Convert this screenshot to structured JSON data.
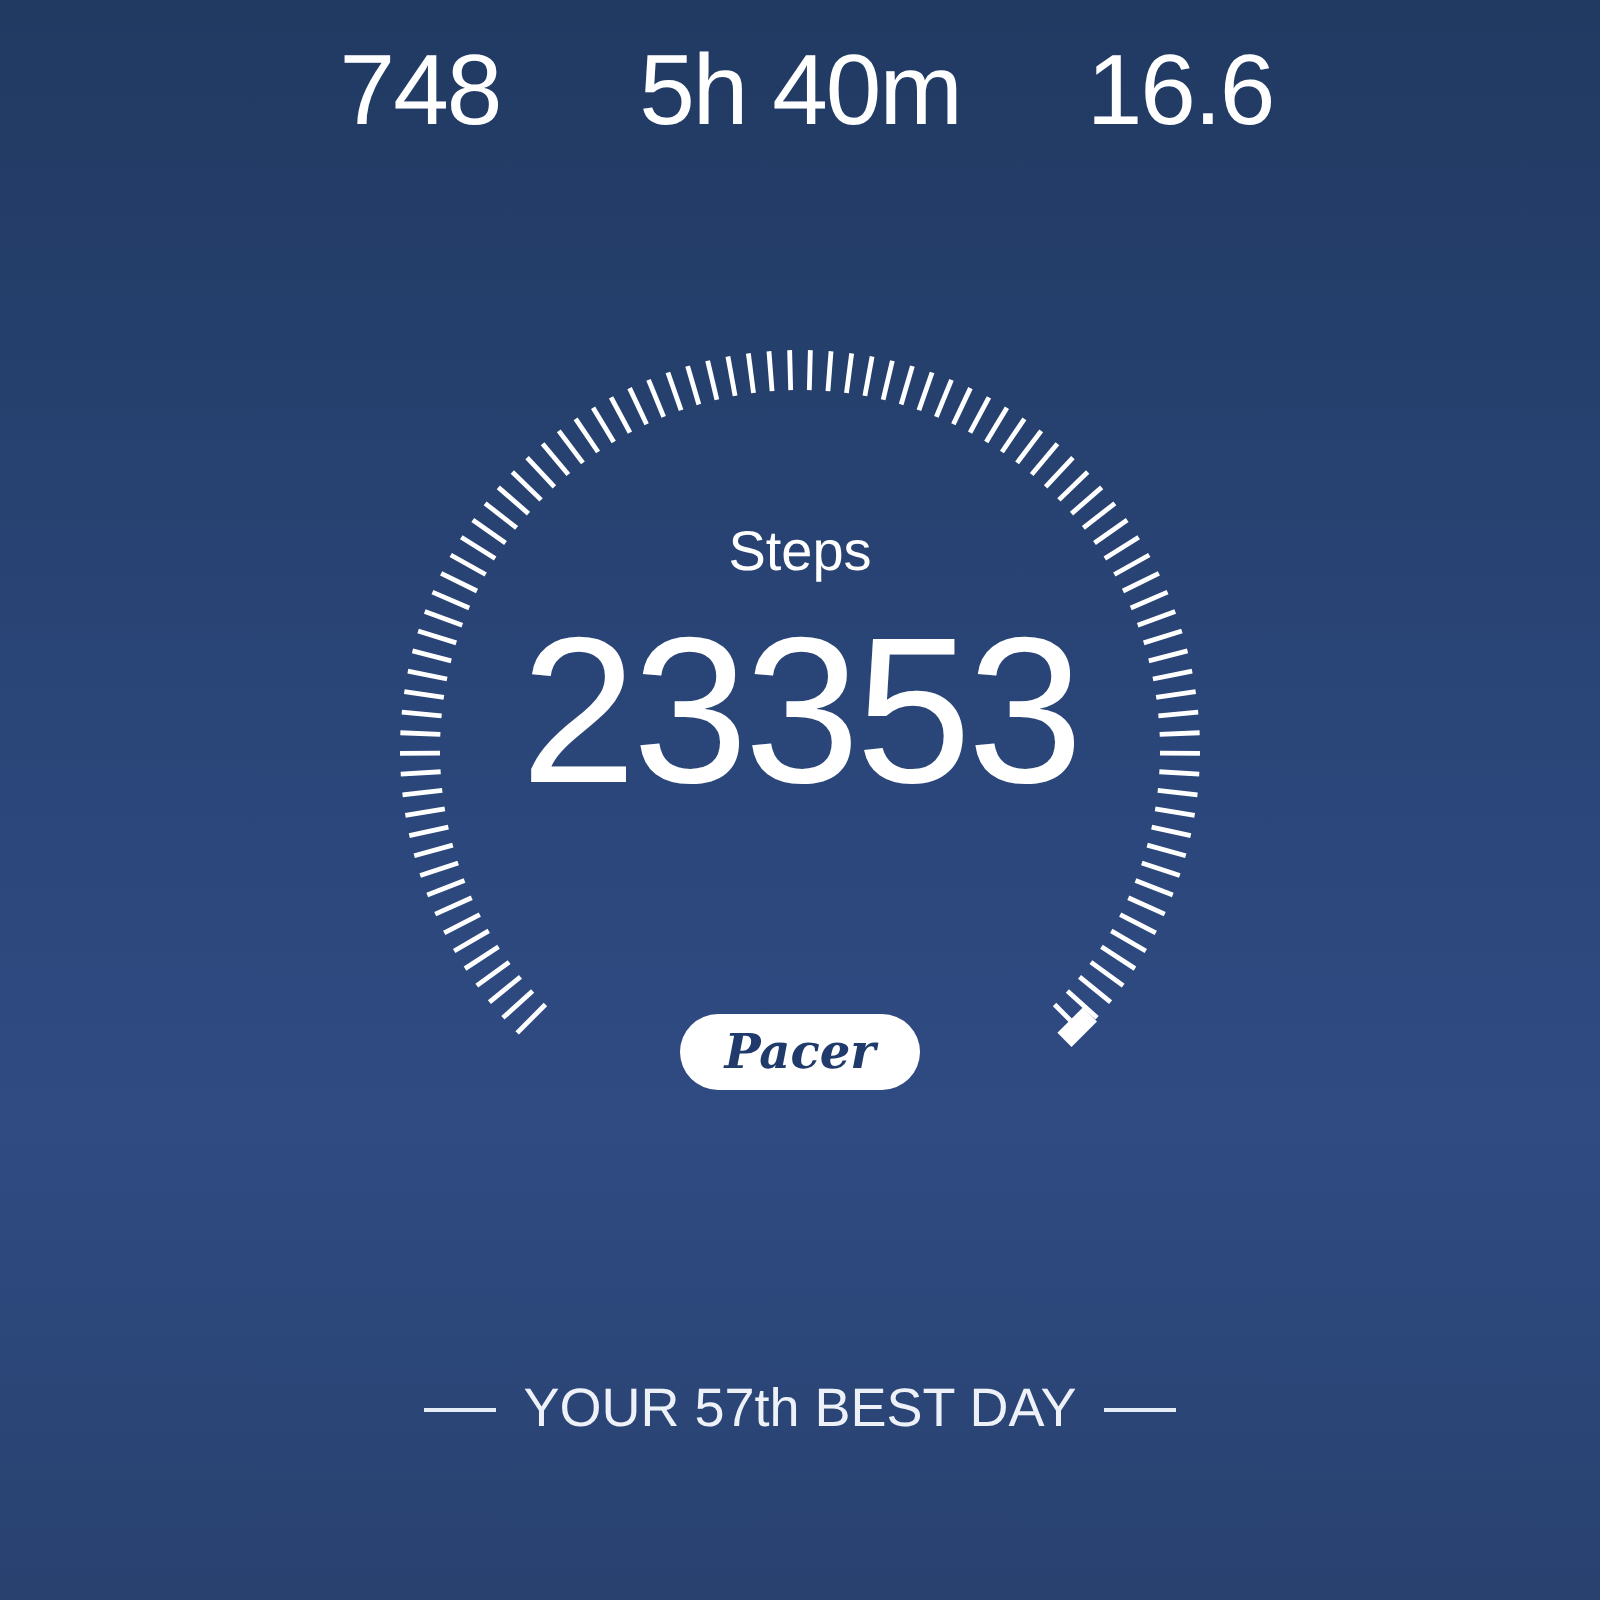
{
  "stats": [
    {
      "value": "748"
    },
    {
      "value": "5h 40m"
    },
    {
      "value": "16.6"
    }
  ],
  "gauge": {
    "label": "Steps",
    "value": "23353",
    "badge": "Pacer"
  },
  "rank": "YOUR 57th BEST DAY"
}
